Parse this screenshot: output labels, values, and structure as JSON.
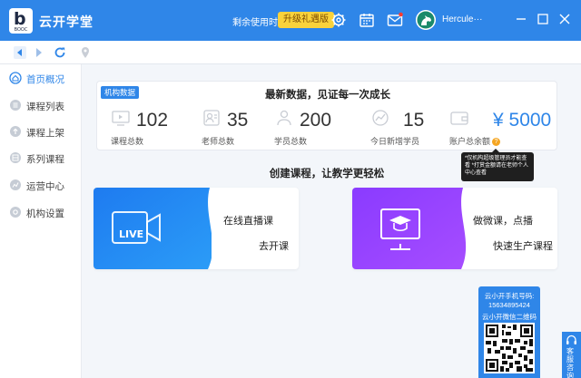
{
  "app": {
    "name": "云开学堂",
    "logo_letter": "b",
    "logo_text": "BOOC"
  },
  "header": {
    "remaining_time": "剩余使用时间：15天",
    "upgrade_label": "升级礼遇版",
    "username": "Hercule···"
  },
  "sidebar": {
    "items": [
      {
        "label": "首页概况",
        "icon": "home-icon"
      },
      {
        "label": "课程列表",
        "icon": "list-icon"
      },
      {
        "label": "课程上架",
        "icon": "upload-icon"
      },
      {
        "label": "系列课程",
        "icon": "series-icon"
      },
      {
        "label": "运营中心",
        "icon": "operations-icon"
      },
      {
        "label": "机构设置",
        "icon": "settings-icon"
      }
    ],
    "active_index": 0
  },
  "stats": {
    "tag": "机构数据",
    "headline": "最新数据，见证每一次成长",
    "items": [
      {
        "value": "102",
        "caption": "课程总数"
      },
      {
        "value": "35",
        "caption": "老师总数"
      },
      {
        "value": "200",
        "caption": "学员总数"
      },
      {
        "value": "15",
        "caption": "今日新增学员"
      },
      {
        "value": "¥ 5000",
        "caption": "账户总余额"
      }
    ],
    "tooltip": "*仅机构超级管理员才能查看 *打赏金额请在老师个人中心查看"
  },
  "create": {
    "title": "创建课程，让教学更轻松",
    "cards": [
      {
        "line1": "在线直播课",
        "line2": "去开课",
        "badge": "LIVE"
      },
      {
        "line1": "做微课，点播",
        "line2": "快速生产课程"
      }
    ]
  },
  "qr": {
    "line1": "云小开手机号码:",
    "line2": "15634895424",
    "line3": "云小开微信二维码"
  },
  "support": {
    "label": "客服咨询"
  },
  "colors": {
    "primary": "#2f86e8",
    "live_gradient_start": "#1e7bf0",
    "vod_gradient_start": "#8a3bff",
    "upgrade": "#f9d23b"
  }
}
